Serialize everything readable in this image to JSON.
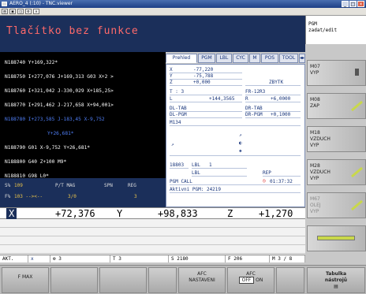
{
  "window": {
    "title": "AERO_4 (:10) - TNC.viewer"
  },
  "header": {
    "title": "Tlačítko bez funkce",
    "mode_line1": "PGM",
    "mode_line2": "zadat/edit"
  },
  "program": {
    "lines": [
      "N188740 Y+169,322*",
      "N188750 I+277,076 J+169,313 G03 X+2 >",
      "N188760 I+321,042 J-330,029 X+185,25>",
      "N188770 I+291,462 J-217,658 X+94,001>",
      "N188780 I+273,585 J-183,45 X-9,752",
      "Y+26,681*",
      "N188790 G01 X-9,752 Y+26,681*",
      "N188800 G40 Z+100 M9*",
      "N188810 G98 L0*"
    ]
  },
  "status": {
    "s_label": "S%",
    "s_val": "109",
    "f_label": "F%",
    "f_val": "103 --><--",
    "cols": [
      "P/T MAG",
      "SPN",
      "REG"
    ],
    "vals": [
      "3/0",
      "",
      "3"
    ]
  },
  "tabs": [
    "Prehled",
    "PGM",
    "LBL",
    "CYC",
    "M",
    "POS",
    "TOOL"
  ],
  "info": {
    "x_label": "X",
    "x_val": "-77,220",
    "y_label": "Y",
    "y_val": "-75,788",
    "z_label": "Z",
    "z_val": "+0,000",
    "zbytek": "ZBYTK",
    "t_label": "T : 3",
    "fr": "FR-12R3",
    "l_label": "L",
    "l_val": "+144,3565",
    "r_label": "R",
    "r_val": "+6,0000",
    "dl_tab": "DL-TAB",
    "dr_tab": "DR-TAB",
    "dl_pgm": "DL-PGM",
    "dr_pgm": "DR-PGM",
    "dr_pgm_val": "+0,1000",
    "m134": "M134",
    "lbl_num": "18803",
    "lbl": "LBL",
    "lbl_val": "1",
    "lbl2": "LBL",
    "rep": "REP",
    "pgm_call": "PGM CALL",
    "time": "01:37:32",
    "aktivni": "Aktivni PGM: 24219"
  },
  "axes": [
    {
      "name": "X",
      "val": "+72,376"
    },
    {
      "name": "Y",
      "val": "+98,833"
    },
    {
      "name": "Z",
      "val": "+1,270"
    }
  ],
  "bottom": {
    "akt": "AKT.",
    "x": "x",
    "tool": "3",
    "t": "T 3",
    "s": "S 2180",
    "f": "F 206",
    "m": "M 3 / 8"
  },
  "side": [
    {
      "l1": "M07",
      "l2": "",
      "l3": "VYP"
    },
    {
      "l1": "M08",
      "l2": "",
      "l3": "ZAP"
    },
    {
      "l1": "M18",
      "l2": "VZDUCH",
      "l3": "VYP"
    },
    {
      "l1": "M28",
      "l2": "VZDUCH",
      "l3": "VYP"
    },
    {
      "l1": "M67",
      "l2": "OLEJ",
      "l3": "VYP"
    }
  ],
  "softkeys": {
    "fmax": "F MAX",
    "afc1_l1": "AFC",
    "afc1_l2": "NASTAVENI",
    "afc2_l1": "AFC",
    "afc2_off": "OFF",
    "afc2_on": "ON",
    "tab_l1": "Tabulka",
    "tab_l2": "nástrojů"
  }
}
